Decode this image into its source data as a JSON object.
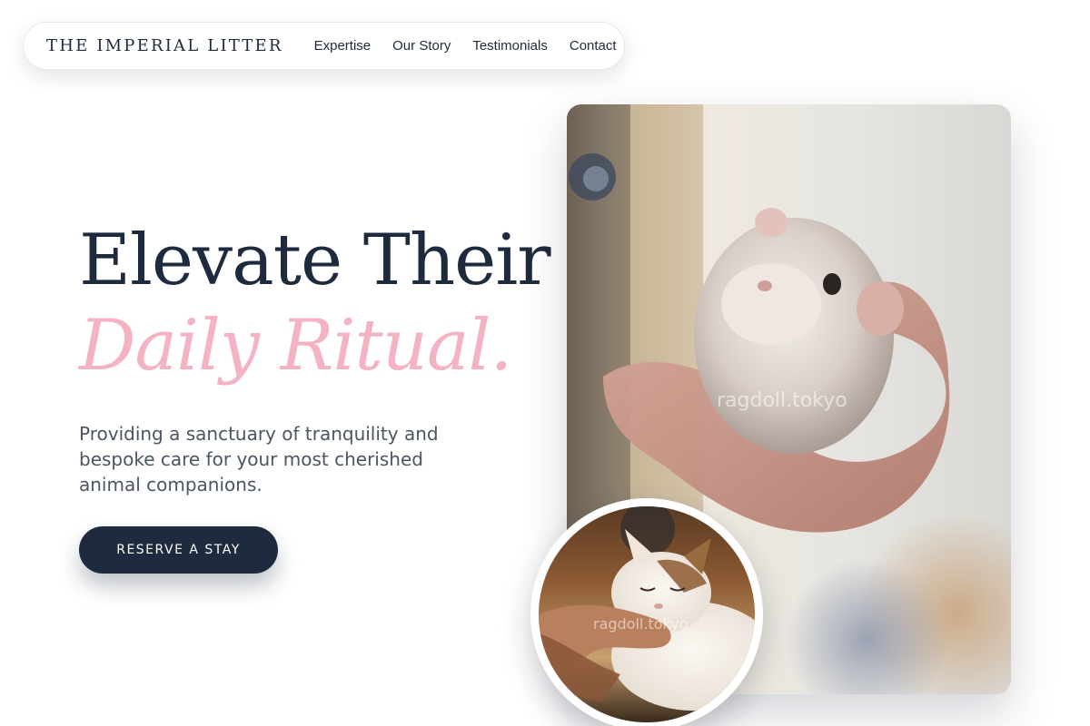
{
  "nav": {
    "brand": "THE IMPERIAL LITTER",
    "links": [
      "Expertise",
      "Our Story",
      "Testimonials",
      "Contact"
    ]
  },
  "hero": {
    "headline_line1": "Elevate Their",
    "headline_line2": "Daily Ritual.",
    "subtext": "Providing a sanctuary of tranquility and bespoke care for your most cherished animal companions.",
    "cta_label": "RESERVE A STAY"
  },
  "media": {
    "main_watermark": "ragdoll.tokyo",
    "inset_watermark": "ragdoll.tokyo"
  },
  "colors": {
    "navy": "#1e2a3d",
    "accent_pink": "#f4b3c2",
    "body_text": "#4b5563",
    "background": "#ffffff"
  }
}
